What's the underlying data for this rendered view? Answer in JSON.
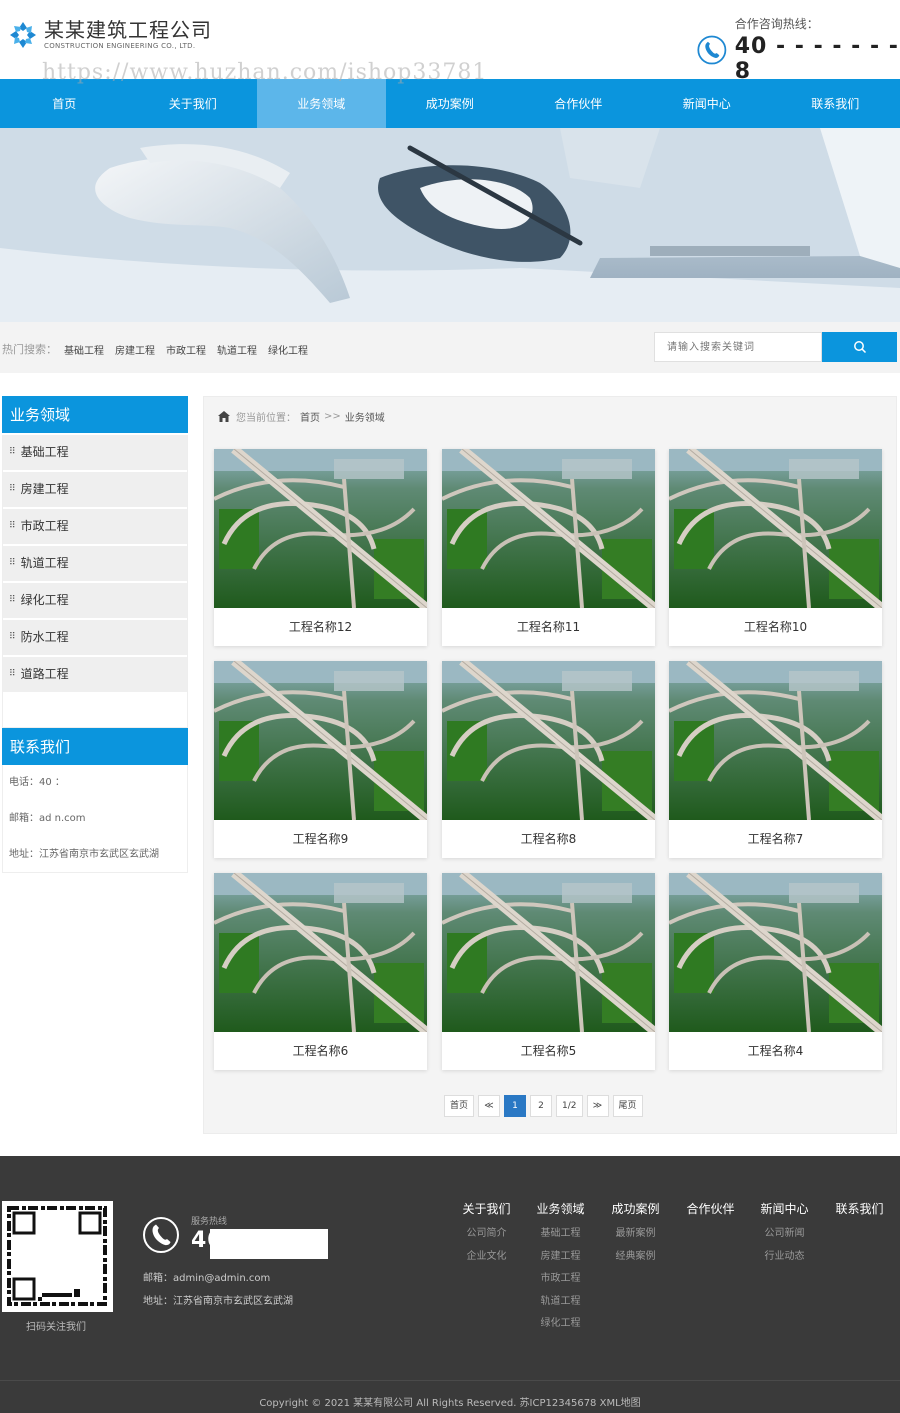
{
  "header": {
    "company_name": "某某建筑工程公司",
    "company_name_en": "CONSTRUCTION ENGINEERING CO., LTD.",
    "hotline_label": "合作咨询热线：",
    "hotline_number": "40 - - - - - - - 8",
    "watermark": "https://www.huzhan.com/ishop33781"
  },
  "nav": [
    {
      "label": "首页",
      "active": false
    },
    {
      "label": "关于我们",
      "active": false
    },
    {
      "label": "业务领域",
      "active": true
    },
    {
      "label": "成功案例",
      "active": false
    },
    {
      "label": "合作伙伴",
      "active": false
    },
    {
      "label": "新闻中心",
      "active": false
    },
    {
      "label": "联系我们",
      "active": false
    }
  ],
  "search": {
    "hot_label": "热门搜索：",
    "hot_links": [
      "基础工程",
      "房建工程",
      "市政工程",
      "轨道工程",
      "绿化工程"
    ],
    "placeholder": "请输入搜索关键词"
  },
  "sidebar": {
    "title": "业务领域",
    "items": [
      "基础工程",
      "房建工程",
      "市政工程",
      "轨道工程",
      "绿化工程",
      "防水工程",
      "道路工程"
    ],
    "contact_title": "联系我们",
    "phone": "电话：40                    ：",
    "email": "邮箱：ad                   n.com",
    "address": "地址：江苏省南京市玄武区玄武湖"
  },
  "breadcrumb": {
    "label": "您当前位置：",
    "home": "首页",
    "sep": ">>",
    "current": "业务领域"
  },
  "projects": [
    "工程名称12",
    "工程名称11",
    "工程名称10",
    "工程名称9",
    "工程名称8",
    "工程名称7",
    "工程名称6",
    "工程名称5",
    "工程名称4"
  ],
  "pagination": {
    "first": "首页",
    "prev": "≪",
    "pages": [
      "1",
      "2"
    ],
    "current": "1",
    "info": "1/2",
    "next": "≫",
    "last": "尾页"
  },
  "footer": {
    "qr_caption": "扫码关注我们",
    "hotline_label": "服务热线",
    "hotline_number": "40                    38",
    "email": "邮箱：admin@admin.com",
    "address": "地址：江苏省南京市玄武区玄武湖",
    "columns": [
      {
        "title": "关于我们",
        "links": [
          "公司简介",
          "企业文化"
        ]
      },
      {
        "title": "业务领域",
        "links": [
          "基础工程",
          "房建工程",
          "市政工程",
          "轨道工程",
          "绿化工程"
        ]
      },
      {
        "title": "成功案例",
        "links": [
          "最新案例",
          "经典案例"
        ]
      },
      {
        "title": "合作伙伴",
        "links": []
      },
      {
        "title": "新闻中心",
        "links": [
          "公司新闻",
          "行业动态"
        ]
      },
      {
        "title": "联系我们",
        "links": []
      }
    ],
    "copyright": "Copyright © 2021 某某有限公司 All Rights Reserved.   苏ICP12345678 XML地图"
  },
  "colors": {
    "brand_blue": "#0b95dd",
    "nav_active": "#5cb6ea",
    "footer_bg": "#3a3a3a",
    "pager_active": "#2a78c4"
  },
  "icons": [
    "logo-mark-icon",
    "phone-icon",
    "home-icon",
    "search-icon",
    "qr-code-icon"
  ]
}
